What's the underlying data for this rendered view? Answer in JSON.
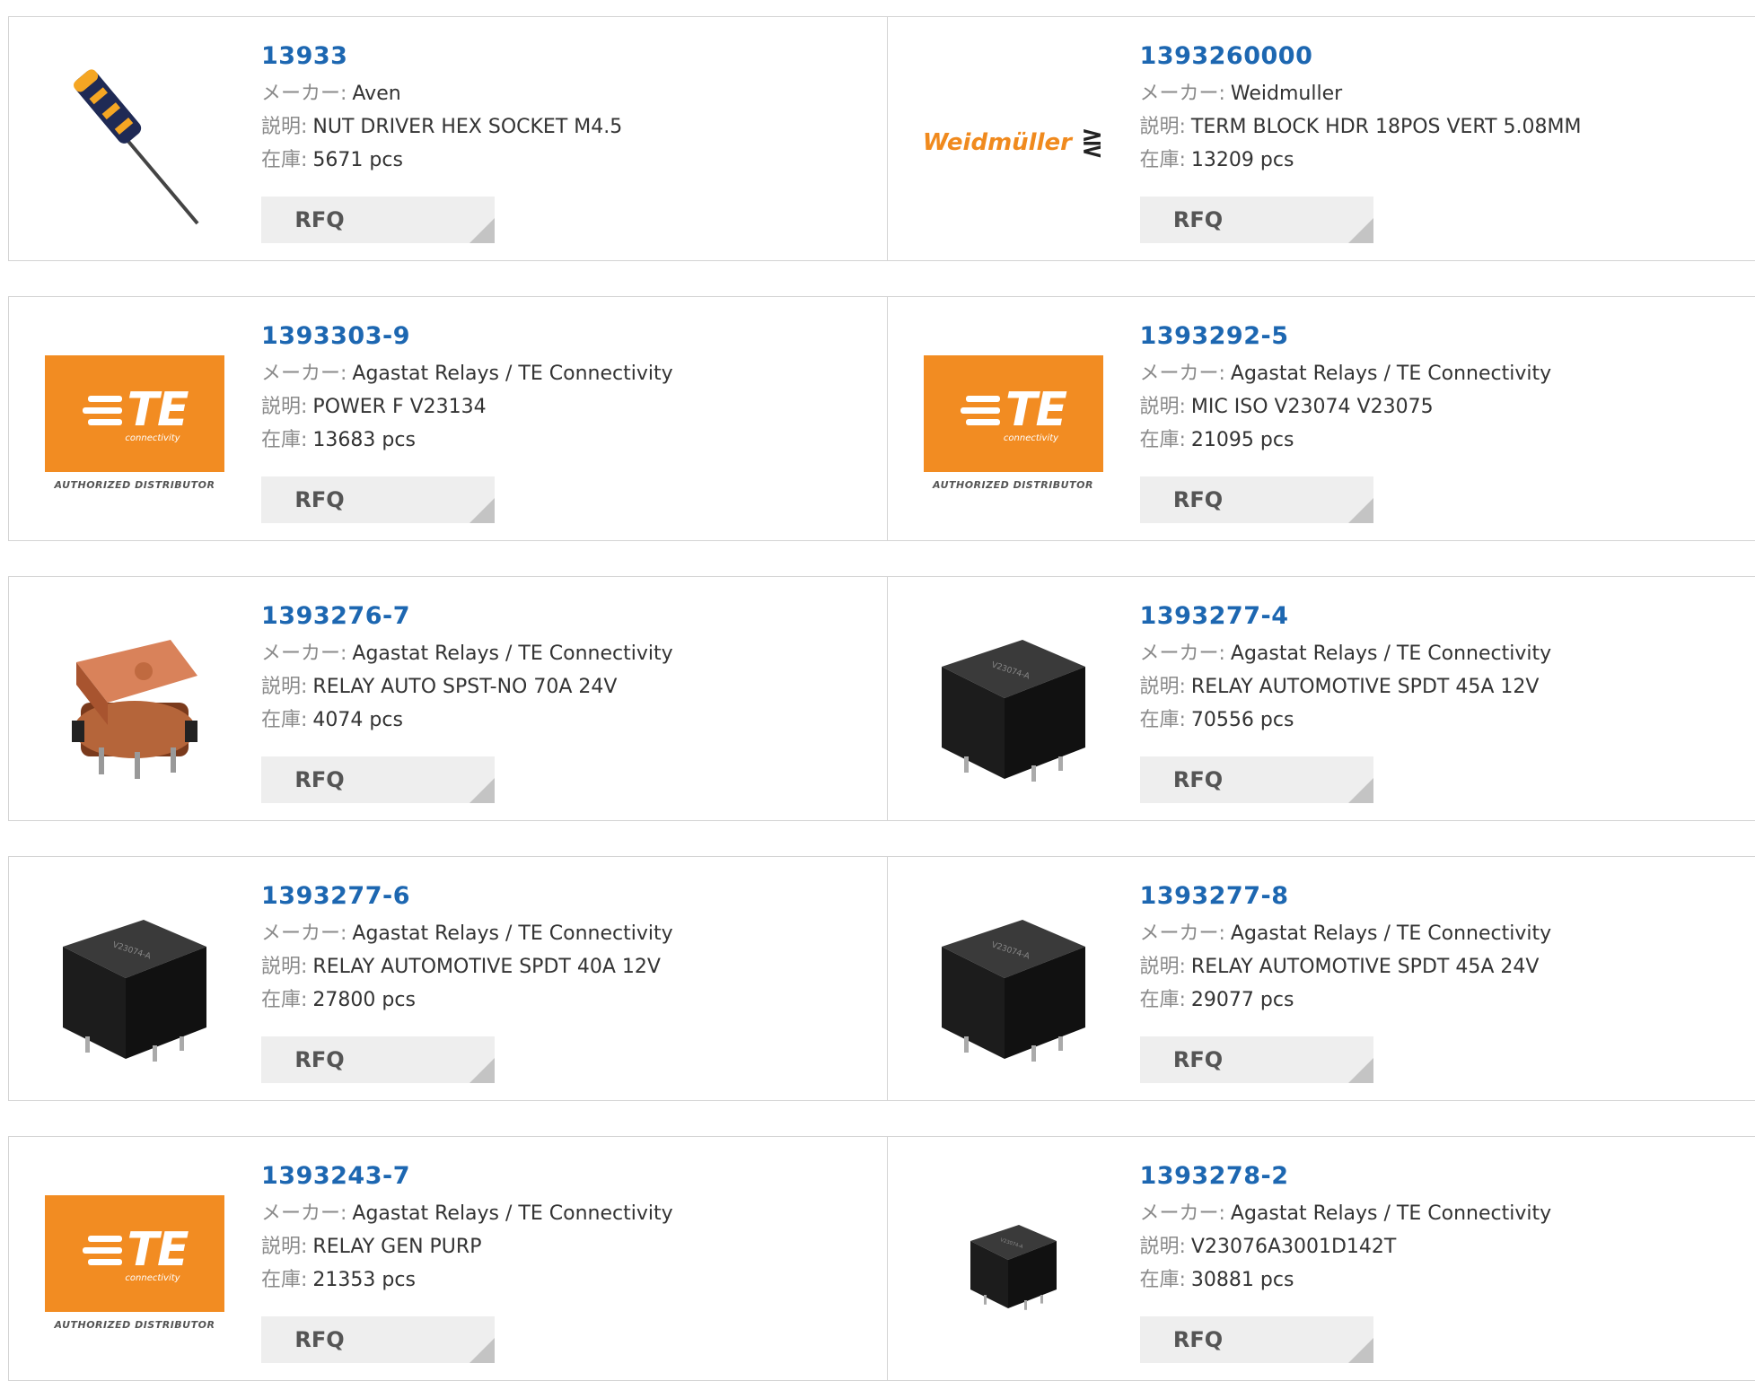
{
  "labels": {
    "maker": "メーカー:",
    "desc": "説明:",
    "stock": "在庫:",
    "rfq": "RFQ"
  },
  "logos": {
    "te_sub": "connectivity",
    "te_letters": "TE",
    "te_authorized": "AUTHORIZED DISTRIBUTOR",
    "weidmuller": "Weidmüller"
  },
  "colors": {
    "link": "#1d67b1",
    "te_orange": "#f28c22",
    "weid_orange": "#f08a1e",
    "rfq_bg": "#eeeeee"
  },
  "products": [
    {
      "pn": "13933",
      "maker": "Aven",
      "desc": "NUT DRIVER HEX SOCKET M4.5",
      "stock": "5671 pcs",
      "image": "screwdriver"
    },
    {
      "pn": "1393260000",
      "maker": "Weidmuller",
      "desc": "TERM BLOCK HDR 18POS VERT 5.08MM",
      "stock": "13209 pcs",
      "image": "weidmuller-logo"
    },
    {
      "pn": "1393303-9",
      "maker": "Agastat Relays / TE Connectivity",
      "desc": "POWER F V23134",
      "stock": "13683 pcs",
      "image": "te-logo"
    },
    {
      "pn": "1393292-5",
      "maker": "Agastat Relays / TE Connectivity",
      "desc": "MIC ISO V23074 V23075",
      "stock": "21095 pcs",
      "image": "te-logo"
    },
    {
      "pn": "1393276-7",
      "maker": "Agastat Relays / TE Connectivity",
      "desc": "RELAY AUTO SPST-NO 70A 24V",
      "stock": "4074 pcs",
      "image": "copper-relay"
    },
    {
      "pn": "1393277-4",
      "maker": "Agastat Relays / TE Connectivity",
      "desc": "RELAY AUTOMOTIVE SPDT 45A 12V",
      "stock": "70556 pcs",
      "image": "black-relay"
    },
    {
      "pn": "1393277-6",
      "maker": "Agastat Relays / TE Connectivity",
      "desc": "RELAY AUTOMOTIVE SPDT 40A 12V",
      "stock": "27800 pcs",
      "image": "black-relay"
    },
    {
      "pn": "1393277-8",
      "maker": "Agastat Relays / TE Connectivity",
      "desc": "RELAY AUTOMOTIVE SPDT 45A 24V",
      "stock": "29077 pcs",
      "image": "black-relay"
    },
    {
      "pn": "1393243-7",
      "maker": "Agastat Relays / TE Connectivity",
      "desc": "RELAY GEN PURP",
      "stock": "21353 pcs",
      "image": "te-logo"
    },
    {
      "pn": "1393278-2",
      "maker": "Agastat Relays / TE Connectivity",
      "desc": "V23076A3001D142T",
      "stock": "30881 pcs",
      "image": "small-black-relay"
    }
  ]
}
